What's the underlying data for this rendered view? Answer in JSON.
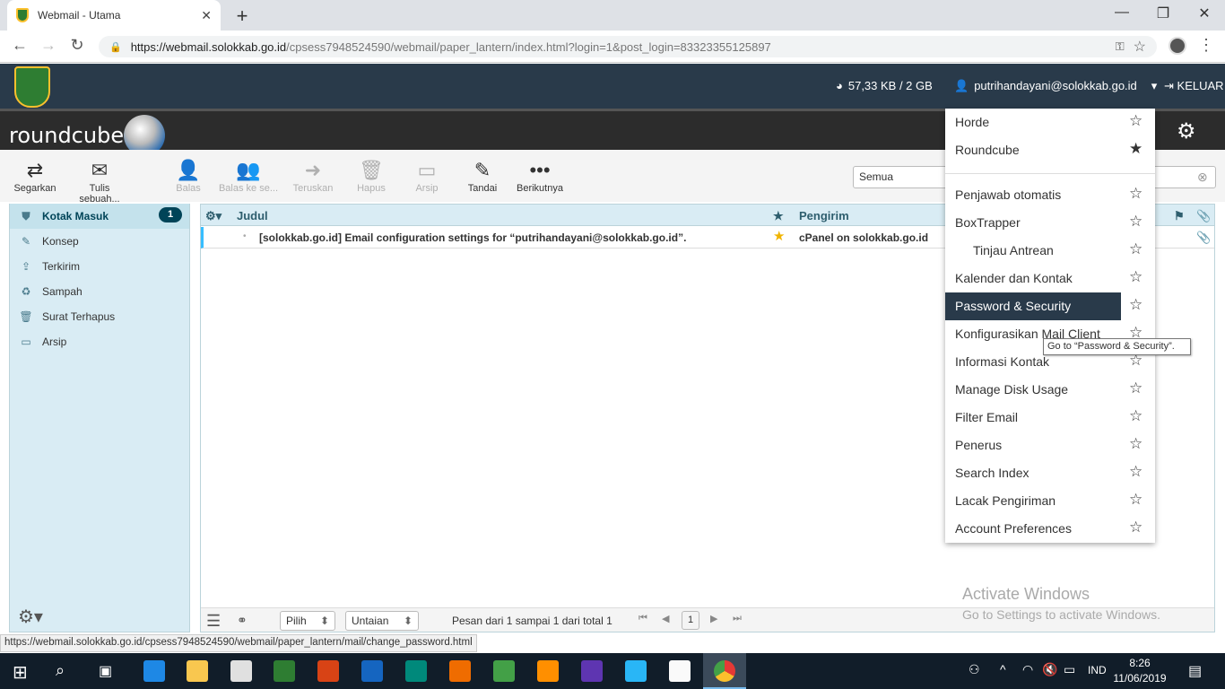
{
  "browser": {
    "tab_title": "Webmail - Utama",
    "new_tab": "+",
    "url_host": "https://webmail.solokkab.go.id",
    "url_path": "/cpsess7948524590/webmail/paper_lantern/index.html?login=1&post_login=83323355125897",
    "status_url": "https://webmail.solokkab.go.id/cpsess7948524590/webmail/paper_lantern/mail/change_password.html"
  },
  "cpanel": {
    "disk_usage": "57,33 KB / 2 GB",
    "user": "putrihandayani@solokkab.go.id",
    "logout": "KELUAR"
  },
  "roundcube": {
    "logo_text": "roundcube"
  },
  "toolbar": {
    "refresh": "Segarkan",
    "compose": "Tulis sebuah...",
    "reply": "Balas",
    "reply_all": "Balas ke se...",
    "forward": "Teruskan",
    "delete": "Hapus",
    "archive": "Arsip",
    "mark": "Tandai",
    "more": "Berikutnya"
  },
  "search": {
    "scope": "Semua"
  },
  "folders": [
    {
      "name": "Kotak Masuk",
      "unread": "1"
    },
    {
      "name": "Konsep"
    },
    {
      "name": "Terkirim"
    },
    {
      "name": "Sampah"
    },
    {
      "name": "Surat Terhapus"
    },
    {
      "name": "Arsip"
    }
  ],
  "list": {
    "col_subject": "Judul",
    "col_sender": "Pengirim",
    "rows": [
      {
        "subject": "[solokkab.go.id] Email configuration settings for “putrihandayani@solokkab.go.id”.",
        "sender": "cPanel on solokkab.go.id",
        "flagged": true
      }
    ],
    "select_label": "Pilih",
    "threads_label": "Untaian",
    "page_info": "Pesan dari 1 sampai 1 dari total 1",
    "page_number": "1"
  },
  "dropdown": {
    "items": [
      {
        "label": "Horde",
        "star": "☆"
      },
      {
        "label": "Roundcube",
        "star": "★"
      },
      {
        "label": "Penjawab otomatis",
        "star": "☆"
      },
      {
        "label": "BoxTrapper",
        "star": "☆"
      },
      {
        "label": "Tinjau Antrean",
        "star": "☆"
      },
      {
        "label": "Kalender dan Kontak",
        "star": "☆"
      },
      {
        "label": "Password & Security",
        "star": "☆"
      },
      {
        "label": "Konfigurasikan Mail Client",
        "star": "☆"
      },
      {
        "label": "Informasi Kontak",
        "star": "☆"
      },
      {
        "label": "Manage Disk Usage",
        "star": "☆"
      },
      {
        "label": "Filter Email",
        "star": "☆"
      },
      {
        "label": "Penerus",
        "star": "☆"
      },
      {
        "label": "Search Index",
        "star": "☆"
      },
      {
        "label": "Lacak Pengiriman",
        "star": "☆"
      },
      {
        "label": "Account Preferences",
        "star": "☆"
      }
    ],
    "tooltip": "Go to “Password & Security”."
  },
  "watermark": {
    "line1": "Activate Windows",
    "line2": "Go to Settings to activate Windows."
  },
  "taskbar": {
    "time": "8:26",
    "date": "11/06/2019",
    "lang": "IND"
  }
}
